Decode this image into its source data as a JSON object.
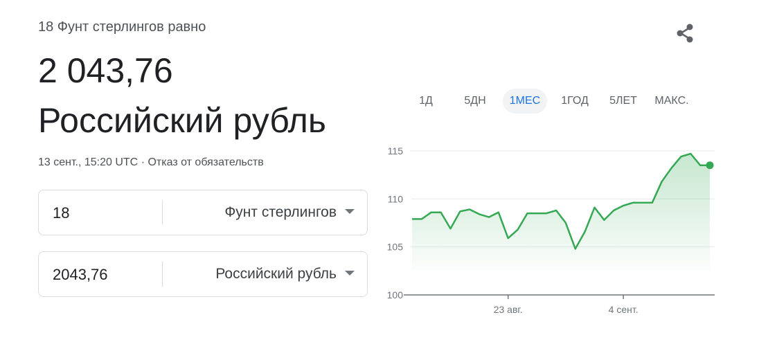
{
  "header": {
    "subtitle": "18 Фунт стерлингов равно",
    "amount": "2 043,76",
    "currency_name": "Российский рубль"
  },
  "meta": {
    "timestamp": "13 сент., 15:20 UTC",
    "separator": "·",
    "disclaimer": "Отказ от обязательств"
  },
  "converter": {
    "from": {
      "value": "18",
      "currency": "Фунт стерлингов"
    },
    "to": {
      "value": "2043,76",
      "currency": "Российский рубль"
    }
  },
  "share_icon": "share-icon",
  "tabs": [
    {
      "label": "1Д",
      "active": false
    },
    {
      "label": "5ДН",
      "active": false
    },
    {
      "label": "1МЕС",
      "active": true
    },
    {
      "label": "1ГОД",
      "active": false
    },
    {
      "label": "5ЛЕТ",
      "active": false
    },
    {
      "label": "МАКС.",
      "active": false
    }
  ],
  "colors": {
    "accent": "#1a73e8",
    "line": "#34a853"
  },
  "chart_data": {
    "type": "line",
    "ylim": [
      100,
      116
    ],
    "yticks": [
      100,
      105,
      110,
      115
    ],
    "xticks": [
      "23 авг.",
      "4 сент."
    ],
    "grid": true,
    "series": [
      {
        "values": [
          107.9,
          107.9,
          108.6,
          108.6,
          106.9,
          108.7,
          108.9,
          108.4,
          108.1,
          108.6,
          105.9,
          106.8,
          108.5,
          108.5,
          108.5,
          108.8,
          107.5,
          104.8,
          106.6,
          109.1,
          107.8,
          108.8,
          109.3,
          109.6,
          109.6,
          109.6,
          111.8,
          113.2,
          114.4,
          114.7,
          113.5,
          113.5
        ]
      }
    ]
  }
}
